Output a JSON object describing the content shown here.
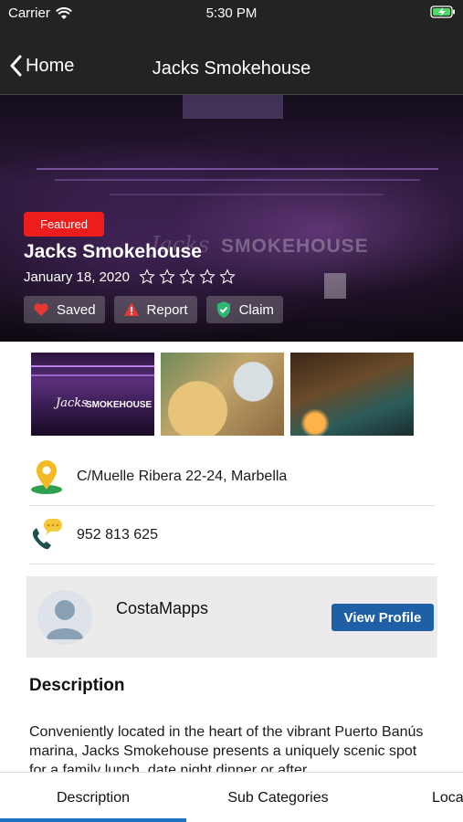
{
  "status_bar": {
    "carrier": "Carrier",
    "time": "5:30 PM"
  },
  "nav": {
    "back_label": "Home",
    "title": "Jacks Smokehouse"
  },
  "hero": {
    "badge": "Featured",
    "title": "Jacks Smokehouse",
    "date": "January 18, 2020",
    "rating": 0,
    "rating_max": 5,
    "actions": [
      {
        "label": "Saved",
        "icon": "heart-icon"
      },
      {
        "label": "Report",
        "icon": "warning-icon"
      },
      {
        "label": "Claim",
        "icon": "shield-check-icon"
      }
    ]
  },
  "gallery": [
    {
      "caption": "SMOKEHOUSE",
      "script": "Jacks"
    },
    {
      "caption": ""
    },
    {
      "caption": ""
    }
  ],
  "info": {
    "address": "C/Muelle Ribera 22-24, Marbella",
    "phone": "952 813 625"
  },
  "profile": {
    "name": "CostaMapps",
    "button": "View Profile"
  },
  "description": {
    "heading": "Description",
    "body": "Conveniently located in the heart of the vibrant Puerto Banús marina, Jacks Smokehouse presents a uniquely scenic spot for a family lunch, date night dinner or after"
  },
  "tabs": [
    {
      "label": "Description",
      "active": true
    },
    {
      "label": "Sub Categories",
      "active": false
    },
    {
      "label": "Loca",
      "active": false
    }
  ],
  "colors": {
    "featured": "#ee1d1d",
    "primary": "#1f5fa5",
    "tab_indicator": "#1f73c4",
    "header": "#232323"
  }
}
